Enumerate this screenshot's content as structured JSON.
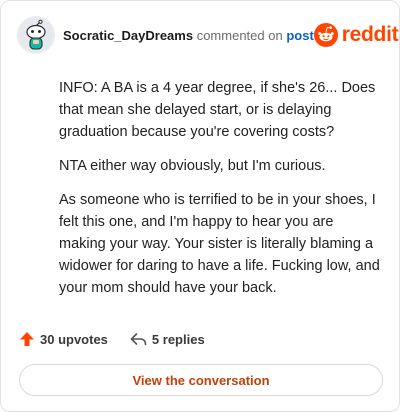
{
  "header": {
    "username": "Socratic_DayDreams",
    "action_text": "commented on",
    "post_link": "post",
    "brand_name": "reddit"
  },
  "comment": {
    "paragraphs": [
      "INFO: A BA is a 4 year degree, if she's 26... Does that mean she delayed start, or is delaying graduation because you're covering costs?",
      "NTA either way obviously, but I'm curious.",
      "As someone who is terrified to be in your shoes, I felt this one, and I'm happy to hear you are making your way. Your sister is literally blaming a widower for daring to have a life. Fucking low, and your mom should have your back."
    ]
  },
  "footer": {
    "upvotes": "30 upvotes",
    "replies": "5 replies",
    "cta_label": "View the conversation"
  },
  "colors": {
    "brand": "#ff4500",
    "link": "#0b5fc5",
    "cta_text": "#c2410c"
  },
  "icons": {
    "avatar": "snoo-avatar-icon",
    "brand": "reddit-logo-icon",
    "upvote": "upvote-arrow-icon",
    "reply": "reply-arrow-icon"
  }
}
